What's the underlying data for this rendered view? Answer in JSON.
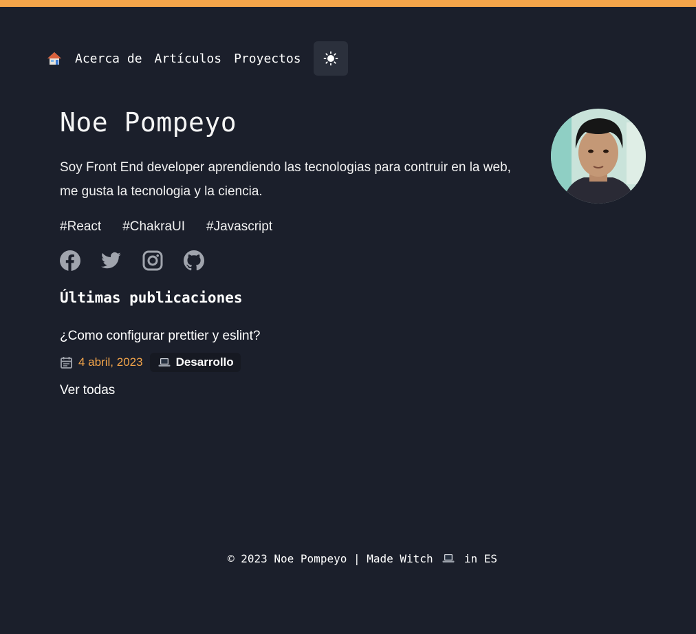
{
  "nav": {
    "home_icon": "house-icon",
    "links": [
      "Acerca de",
      "Artículos",
      "Proyectos"
    ],
    "theme_icon": "sun-icon"
  },
  "profile": {
    "name": "Noe Pompeyo",
    "bio": "Soy Front End developer aprendiendo las tecnologias para contruir en la web, me gusta la tecnologia y la ciencia.",
    "tags": [
      "#React",
      "#ChakraUI",
      "#Javascript"
    ],
    "social_icons": [
      "facebook-icon",
      "twitter-icon",
      "instagram-icon",
      "github-icon"
    ]
  },
  "posts": {
    "heading": "Últimas publicaciones",
    "items": [
      {
        "title": "¿Como configurar prettier y eslint?",
        "date": "4 abril, 2023",
        "category": "Desarrollo"
      }
    ],
    "see_all": "Ver todas"
  },
  "footer": {
    "prefix": "© 2023 Noe Pompeyo | Made Witch",
    "suffix": "in ES"
  },
  "colors": {
    "background": "#1b1f2b",
    "accent": "#f4a54a",
    "theme_button_bg": "#2b303c",
    "badge_bg": "#161922",
    "icon_gray": "#a0a4ad"
  }
}
